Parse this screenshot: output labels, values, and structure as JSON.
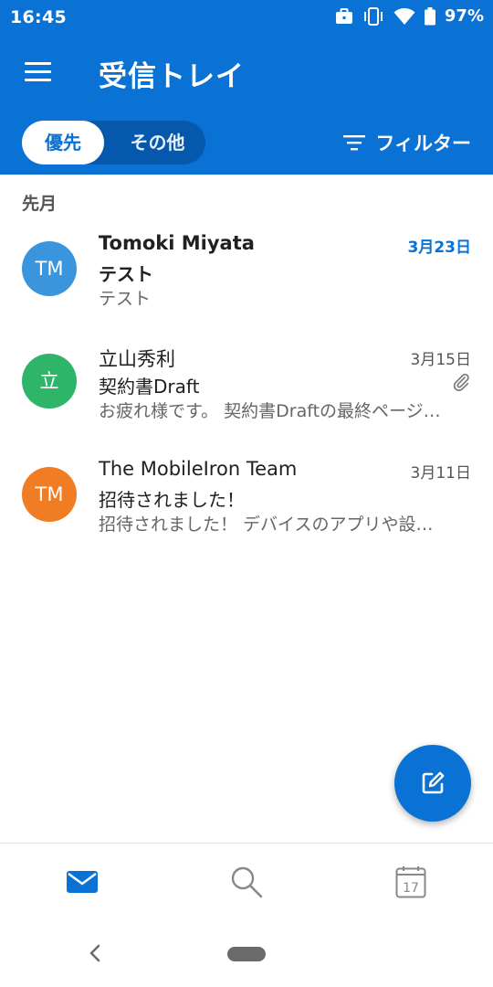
{
  "status": {
    "time": "16:45",
    "battery": "97%"
  },
  "header": {
    "title": "受信トレイ"
  },
  "tabs": {
    "focused": "優先",
    "other": "その他"
  },
  "filter": {
    "label": "フィルター"
  },
  "section": {
    "label": "先月"
  },
  "emails": [
    {
      "initials": "TM",
      "avatar_color": "#3a95dc",
      "sender": "Tomoki Miyata",
      "date": "3月23日",
      "subject": "テスト",
      "preview": "テスト",
      "unread": true,
      "attachment": false
    },
    {
      "initials": "立",
      "avatar_color": "#2fb56a",
      "sender": "立山秀利",
      "date": "3月15日",
      "subject": "契約書Draft",
      "preview": "お疲れ様です。 契約書Draftの最終ページ…",
      "unread": false,
      "attachment": true
    },
    {
      "initials": "TM",
      "avatar_color": "#f07c23",
      "sender": "The MobileIron Team",
      "date": "3月11日",
      "subject": "招待されました！",
      "preview": "招待されました！ デバイスのアプリや設…",
      "unread": false,
      "attachment": false
    }
  ],
  "bottom_nav": {
    "calendar_day": "17"
  },
  "colors": {
    "accent": "#0a72d4",
    "toggle_bg": "#0658ad"
  },
  "icons": [
    "menu-icon",
    "filter-icon",
    "paperclip-icon",
    "compose-icon",
    "mail-icon",
    "search-icon",
    "calendar-icon",
    "back-icon"
  ]
}
